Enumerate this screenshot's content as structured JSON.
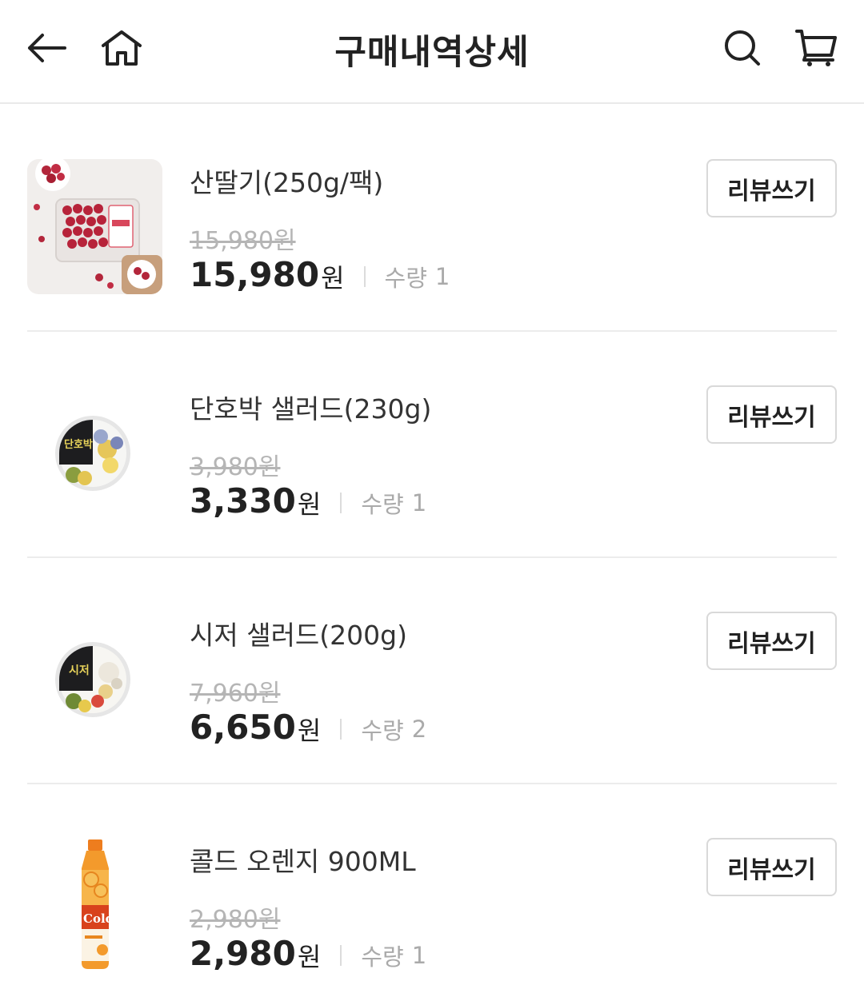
{
  "header": {
    "title": "구매내역상세",
    "icons": [
      "arrow-left-icon",
      "home-icon",
      "search-icon",
      "cart-icon"
    ]
  },
  "colors": {
    "text": "#222222",
    "muted": "#aaaaaa",
    "strike": "#b5b5b5",
    "border": "#d9d9d9",
    "divider": "#ececec"
  },
  "items": [
    {
      "name": "산딸기(250g/팩)",
      "original_price": "15,980원",
      "price": "15,980",
      "price_unit": "원",
      "qty_label": "수량",
      "qty": "1",
      "review_label": "리뷰쓰기",
      "thumbnail": "raspberry-pack-image"
    },
    {
      "name": "단호박 샐러드(230g)",
      "original_price": "3,980원",
      "price": "3,330",
      "price_unit": "원",
      "qty_label": "수량",
      "qty": "1",
      "review_label": "리뷰쓰기",
      "thumbnail": "pumpkin-salad-image",
      "thumbnail_label": "단호박"
    },
    {
      "name": "시저 샐러드(200g)",
      "original_price": "7,960원",
      "price": "6,650",
      "price_unit": "원",
      "qty_label": "수량",
      "qty": "2",
      "review_label": "리뷰쓰기",
      "thumbnail": "caesar-salad-image",
      "thumbnail_label": "시저"
    },
    {
      "name": "콜드 오렌지 900ML",
      "original_price": "2,980원",
      "price": "2,980",
      "price_unit": "원",
      "qty_label": "수량",
      "qty": "1",
      "review_label": "리뷰쓰기",
      "thumbnail": "orange-juice-bottle-image",
      "thumbnail_label": "Cold"
    }
  ]
}
